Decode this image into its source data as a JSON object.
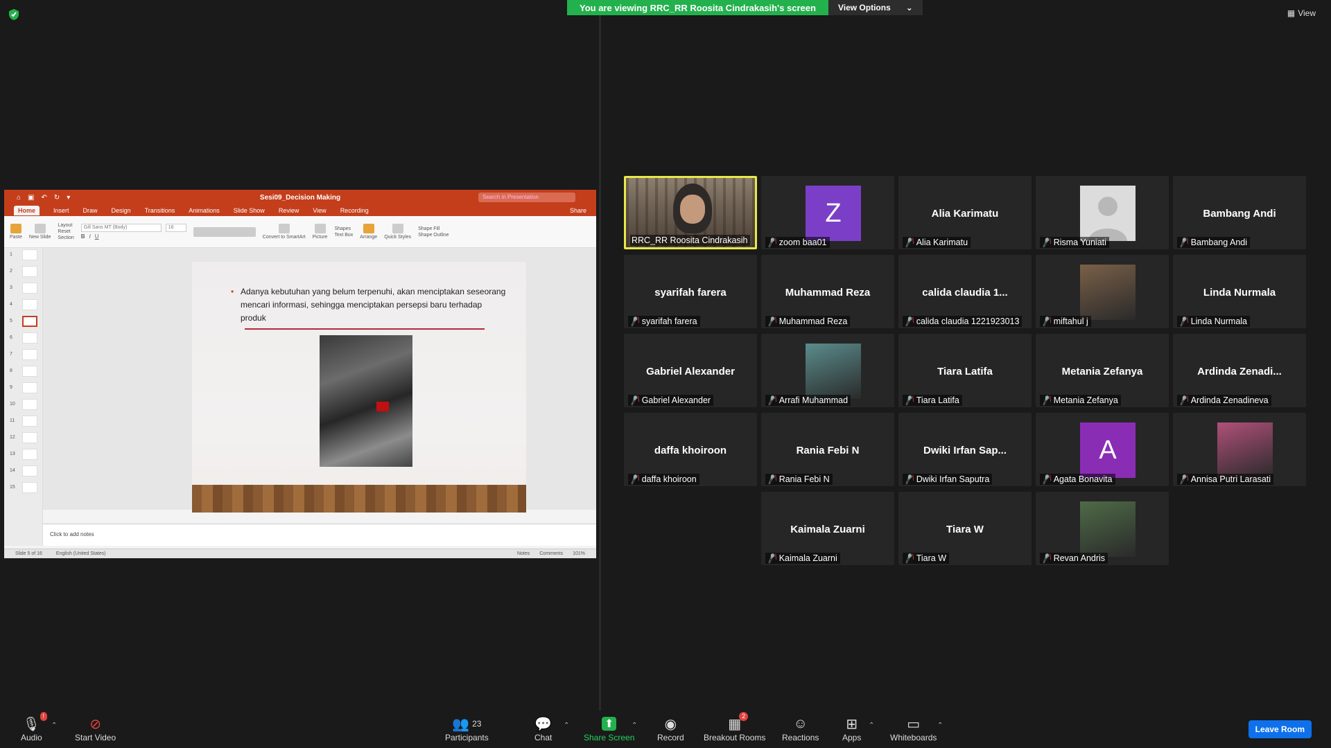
{
  "banner": {
    "viewing": "You are viewing RRC_RR Roosita Cindrakasih's screen",
    "view_options": "View Options"
  },
  "view_button": "View",
  "ppt": {
    "title": "Sesi09_Decision Making",
    "search_placeholder": "Search in Presentation",
    "tabs": [
      "Home",
      "Insert",
      "Draw",
      "Design",
      "Transitions",
      "Animations",
      "Slide Show",
      "Review",
      "View",
      "Recording"
    ],
    "share": "Share",
    "ribbon": {
      "paste": "Paste",
      "new_slide": "New Slide",
      "layout": "Layout",
      "reset": "Reset",
      "section": "Section",
      "font": "Gill Sans MT (Body)",
      "size": "16",
      "convert": "Convert to SmartArt",
      "picture": "Picture",
      "shapes": "Shapes",
      "text_box": "Text Box",
      "arrange": "Arrange",
      "quick_styles": "Quick Styles",
      "shape_fill": "Shape Fill",
      "shape_outline": "Shape Outline"
    },
    "thumbs": [
      "1",
      "2",
      "3",
      "4",
      "5",
      "6",
      "7",
      "8",
      "9",
      "10",
      "11",
      "12",
      "13",
      "14",
      "15"
    ],
    "slide_bullet": "Adanya kebutuhan yang belum terpenuhi, akan menciptakan seseorang mencari informasi, sehingga menciptakan persepsi baru terhadap produk",
    "notes_placeholder": "Click to add notes",
    "status_slide": "Slide 5 of 16",
    "status_lang": "English (United States)",
    "status_notes": "Notes",
    "status_comments": "Comments",
    "zoom": "101%"
  },
  "participants": [
    {
      "big": "",
      "label": "RRC_RR Roosita Cindrakasih",
      "type": "video",
      "muted": false,
      "active": true
    },
    {
      "big": "",
      "label": "zoom baa01",
      "type": "letter",
      "letter": "Z",
      "color": "#7b3fc7",
      "muted": true
    },
    {
      "big": "Alia Karimatu",
      "label": "Alia Karimatu",
      "type": "name",
      "muted": true
    },
    {
      "big": "",
      "label": "Risma Yuniati",
      "type": "default",
      "muted": true
    },
    {
      "big": "Bambang Andi",
      "label": "Bambang Andi",
      "type": "name",
      "muted": true
    },
    {
      "big": "syarifah farera",
      "label": "syarifah farera",
      "type": "name",
      "muted": true
    },
    {
      "big": "Muhammad Reza",
      "label": "Muhammad Reza",
      "type": "name",
      "muted": true
    },
    {
      "big": "calida  claudia  1...",
      "label": "calida claudia 1221923013",
      "type": "name",
      "muted": true
    },
    {
      "big": "",
      "label": "miftahul j",
      "type": "photo",
      "color": "#7a6048",
      "muted": true
    },
    {
      "big": "Linda Nurmala",
      "label": "Linda Nurmala",
      "type": "name",
      "muted": true
    },
    {
      "big": "Gabriel Alexander",
      "label": "Gabriel Alexander",
      "type": "name",
      "muted": true
    },
    {
      "big": "",
      "label": "Arrafi Muhammad",
      "type": "photo",
      "color": "#5b8c8c",
      "muted": true
    },
    {
      "big": "Tiara Latifa",
      "label": "Tiara Latifa",
      "type": "name",
      "muted": true
    },
    {
      "big": "Metania Zefanya",
      "label": "Metania Zefanya",
      "type": "name",
      "muted": true
    },
    {
      "big": "Ardinda  Zenadi...",
      "label": "Ardinda Zenadineva",
      "type": "name",
      "muted": true
    },
    {
      "big": "daffa khoiroon",
      "label": "daffa khoiroon",
      "type": "name",
      "muted": true
    },
    {
      "big": "Rania Febi N",
      "label": "Rania Febi N",
      "type": "name",
      "muted": true
    },
    {
      "big": "Dwiki  Irfan  Sap...",
      "label": "Dwiki Irfan Saputra",
      "type": "name",
      "muted": true
    },
    {
      "big": "",
      "label": "Agata Bonavita",
      "type": "letter",
      "letter": "A",
      "color": "#8a2db5",
      "muted": true
    },
    {
      "big": "",
      "label": "Annisa Putri Larasati",
      "type": "photo",
      "color": "#b0507a",
      "muted": true
    },
    {
      "big": "Kaimala Zuarni",
      "label": "Kaimala Zuarni",
      "type": "name",
      "muted": true
    },
    {
      "big": "Tiara W",
      "label": "Tiara W",
      "type": "name",
      "muted": true
    },
    {
      "big": "",
      "label": "Revan Andris",
      "type": "photo",
      "color": "#4f6b48",
      "muted": true
    }
  ],
  "toolbar": {
    "audio": "Audio",
    "audio_badge": "!",
    "start_video": "Start Video",
    "participants": "Participants",
    "participants_count": "23",
    "chat": "Chat",
    "share_screen": "Share Screen",
    "record": "Record",
    "breakout": "Breakout Rooms",
    "breakout_badge": "2",
    "reactions": "Reactions",
    "apps": "Apps",
    "whiteboards": "Whiteboards",
    "leave": "Leave Room"
  },
  "colors": {
    "banner_green": "#23b14d",
    "leave_blue": "#0e71eb",
    "active_border": "#e8e84a",
    "ppt_red": "#c43e1c",
    "muted_red": "#e0423c"
  }
}
